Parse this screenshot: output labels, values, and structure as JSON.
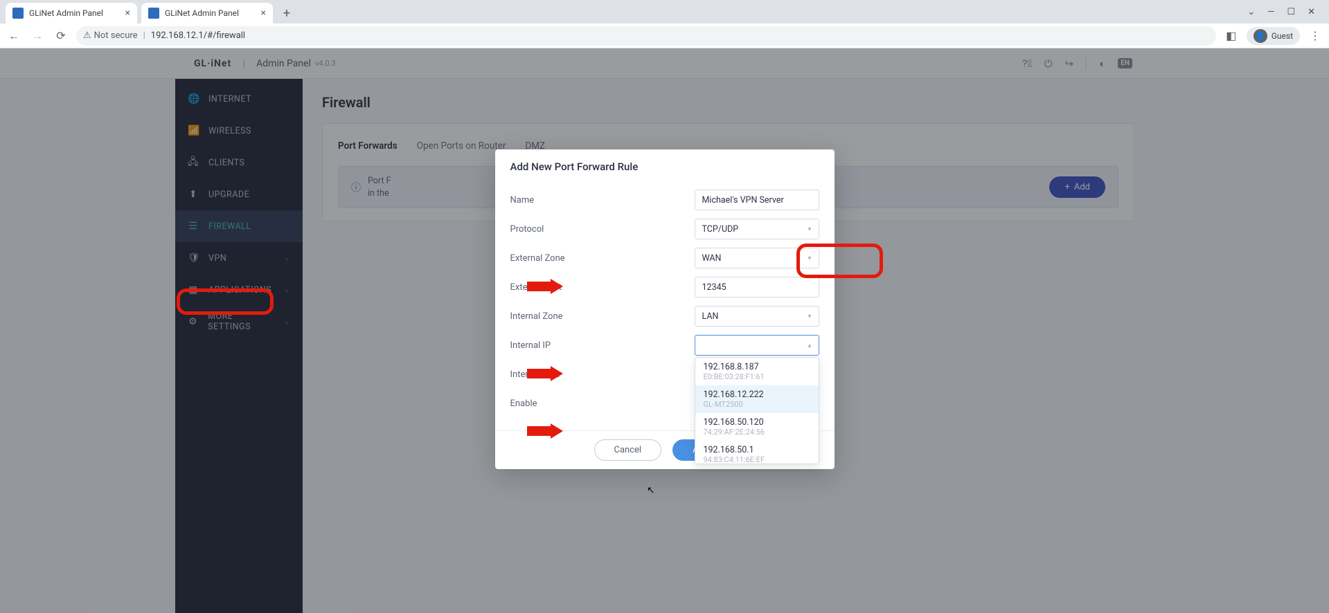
{
  "browser": {
    "tabs": [
      {
        "title": "GLiNet Admin Panel"
      },
      {
        "title": "GLiNet Admin Panel"
      }
    ],
    "url_host_prefix": "Not secure",
    "url": "192.168.12.1/#/firewall",
    "guest_label": "Guest",
    "window_controls": {
      "min": "—",
      "max": "☐",
      "close": "✕",
      "chev": "⌄"
    }
  },
  "header": {
    "brand": "GL·iNet",
    "title": "Admin Panel",
    "version": "v4.0.3",
    "lang": "EN"
  },
  "sidebar": {
    "items": [
      {
        "label": "INTERNET",
        "glyph": "🌐"
      },
      {
        "label": "WIRELESS",
        "glyph": "📶"
      },
      {
        "label": "CLIENTS",
        "glyph": "🖧"
      },
      {
        "label": "UPGRADE",
        "glyph": "⬆"
      },
      {
        "label": "FIREWALL",
        "glyph": "☰",
        "active": true
      },
      {
        "label": "VPN",
        "glyph": "🛡",
        "expandable": true
      },
      {
        "label": "APPLICATIONS",
        "glyph": "▦",
        "expandable": true
      },
      {
        "label": "MORE SETTINGS",
        "glyph": "⚙",
        "expandable": true
      }
    ]
  },
  "page": {
    "title": "Firewall",
    "tabs": [
      {
        "label": "Port Forwards",
        "active": true
      },
      {
        "label": "Open Ports on Router"
      },
      {
        "label": "DMZ"
      }
    ],
    "info_line1": "Port F",
    "info_line2": "in the",
    "add_button": "Add"
  },
  "modal": {
    "title": "Add New Port Forward Rule",
    "fields": {
      "name_label": "Name",
      "name_value": "Michael's VPN Server",
      "protocol_label": "Protocol",
      "protocol_value": "TCP/UDP",
      "ext_zone_label": "External Zone",
      "ext_zone_value": "WAN",
      "ext_port_label": "External Port",
      "ext_port_value": "12345",
      "int_zone_label": "Internal Zone",
      "int_zone_value": "LAN",
      "int_ip_label": "Internal IP",
      "int_ip_value": "",
      "int_port_label": "Internal Port",
      "enable_label": "Enable"
    },
    "ip_options": [
      {
        "ip": "192.168.8.187",
        "mac": "E0:BE:03:28:F1:61"
      },
      {
        "ip": "192.168.12.222",
        "mac": "GL-MT2500",
        "hover": true
      },
      {
        "ip": "192.168.50.120",
        "mac": "74:29:AF:2E:24:56"
      },
      {
        "ip": "192.168.50.1",
        "mac": "94:83:C4:11:6E:EF"
      }
    ],
    "buttons": {
      "cancel": "Cancel",
      "apply": "Apply"
    }
  }
}
